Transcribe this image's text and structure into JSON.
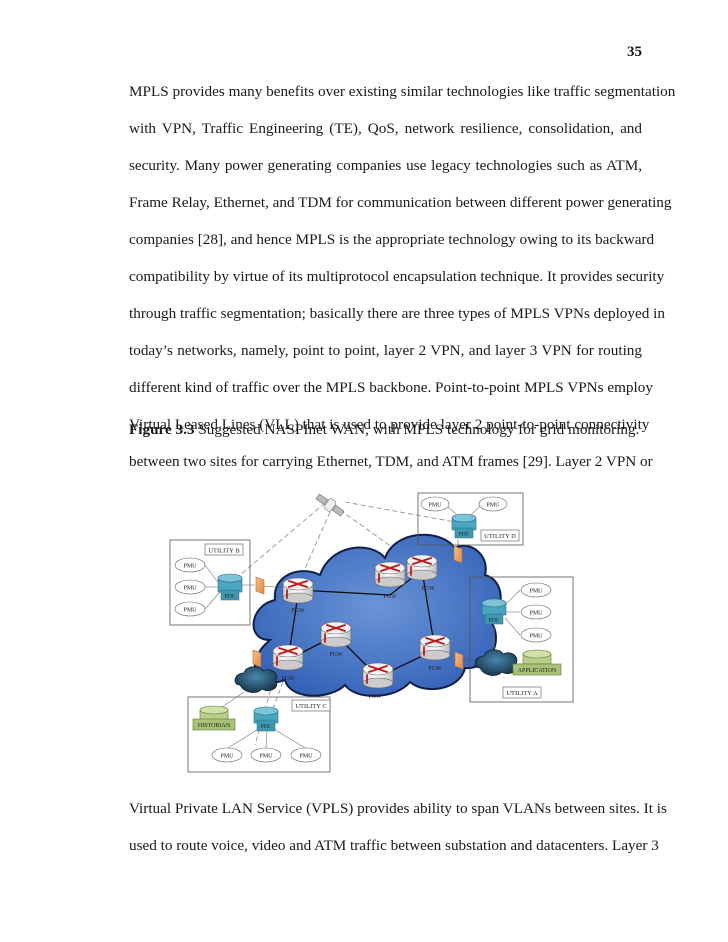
{
  "page_number": "35",
  "paragraph1": {
    "lines": [
      "MPLS provides many benefits over existing similar technologies like traffic segmentation",
      "with VPN, Traffic Engineering (TE), QoS, network resilience, consolidation, and",
      "security. Many power generating companies use legacy technologies such as ATM,",
      "Frame Relay, Ethernet, and TDM for communication between different power generating",
      "companies [28], and hence MPLS is the appropriate technology owing to its backward",
      "compatibility by virtue of its multiprotocol encapsulation technique. It provides security",
      "through traffic segmentation; basically there are three types of MPLS VPNs deployed in",
      "today’s networks, namely, point to point, layer 2 VPN, and layer 3 VPN for routing",
      "different kind of traffic over the MPLS backbone. Point-to-point MPLS VPNs employ",
      "Virtual Leased Lines (VLL) that is used to provide layer 2 point-to-point connectivity",
      "between two sites for carrying Ethernet, TDM, and ATM frames [29]. Layer 2 VPN or"
    ]
  },
  "figure": {
    "label": "Figure 3.3",
    "caption": " Suggested NASPInet WAN, with MPLS technology for grid monitoring.",
    "diagram": {
      "colors": {
        "cloud": "#3d6fc4",
        "cloud_outline": "#0d1f4a",
        "pdc": "#4aa6bf",
        "application": "#b8cf8a",
        "firewall": "#f0a060",
        "router_arrow": "#c01818",
        "dark_cloud": "#2a5a7a"
      },
      "router_label": "PGW",
      "utility_b": {
        "label": "UTILITY B",
        "pmus": [
          "PMU",
          "PMU",
          "PMU"
        ],
        "pdc": "PDC"
      },
      "utility_d": {
        "label": "UTILITY D",
        "pmus": [
          "PMU",
          "PMU"
        ],
        "pdc": "PDC"
      },
      "utility_a": {
        "label": "UTILITY A",
        "pmus": [
          "PMU",
          "PMU",
          "PMU"
        ],
        "pdc": "PDC",
        "application": "APPLICATION"
      },
      "utility_c": {
        "label": "UTILITY C",
        "pmus": [
          "PMU",
          "PMU",
          "PMU"
        ],
        "pdc": "PDC",
        "historian": "HISTORIAN"
      }
    }
  },
  "paragraph2": {
    "lines": [
      "Virtual Private LAN Service (VPLS) provides ability to span VLANs between sites. It is",
      "used to route voice, video and ATM traffic between substation and datacenters. Layer 3"
    ]
  }
}
